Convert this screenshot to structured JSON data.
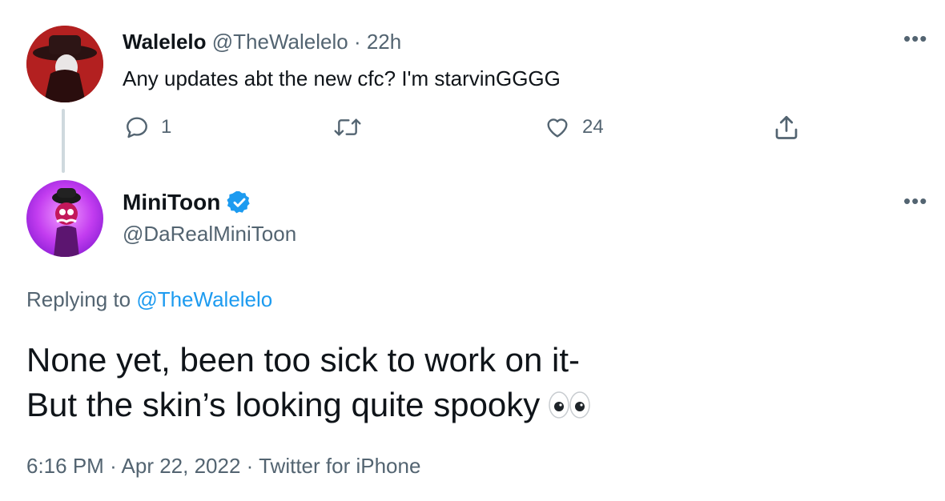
{
  "parent_tweet": {
    "display_name": "Walelelo",
    "handle": "@TheWalelelo",
    "separator": "·",
    "time_ago": "22h",
    "text": "Any updates abt the new cfc? I'm starvinGGGG",
    "more_label": "•••",
    "reply_count": "1",
    "retweet_count": "",
    "like_count": "24"
  },
  "main_tweet": {
    "display_name": "MiniToon",
    "handle": "@DaRealMiniToon",
    "verified": true,
    "more_label": "•••",
    "replying_prefix": "Replying to",
    "replying_handle": "@TheWalelelo",
    "text_line1": "None yet, been too sick to work on it-",
    "text_line2": "But the skin’s looking quite spooky",
    "emoji": "eyes",
    "time": "6:16 PM",
    "date": "Apr 22, 2022",
    "source": "Twitter for iPhone",
    "meta_separator": "·"
  },
  "colors": {
    "accent": "#1d9bf0",
    "muted": "#536471",
    "text": "#0f1419",
    "thread_line": "#cfd9de"
  },
  "icons": [
    "reply-icon",
    "retweet-icon",
    "like-icon",
    "share-icon",
    "verified-badge-icon",
    "eyes-emoji-icon"
  ]
}
